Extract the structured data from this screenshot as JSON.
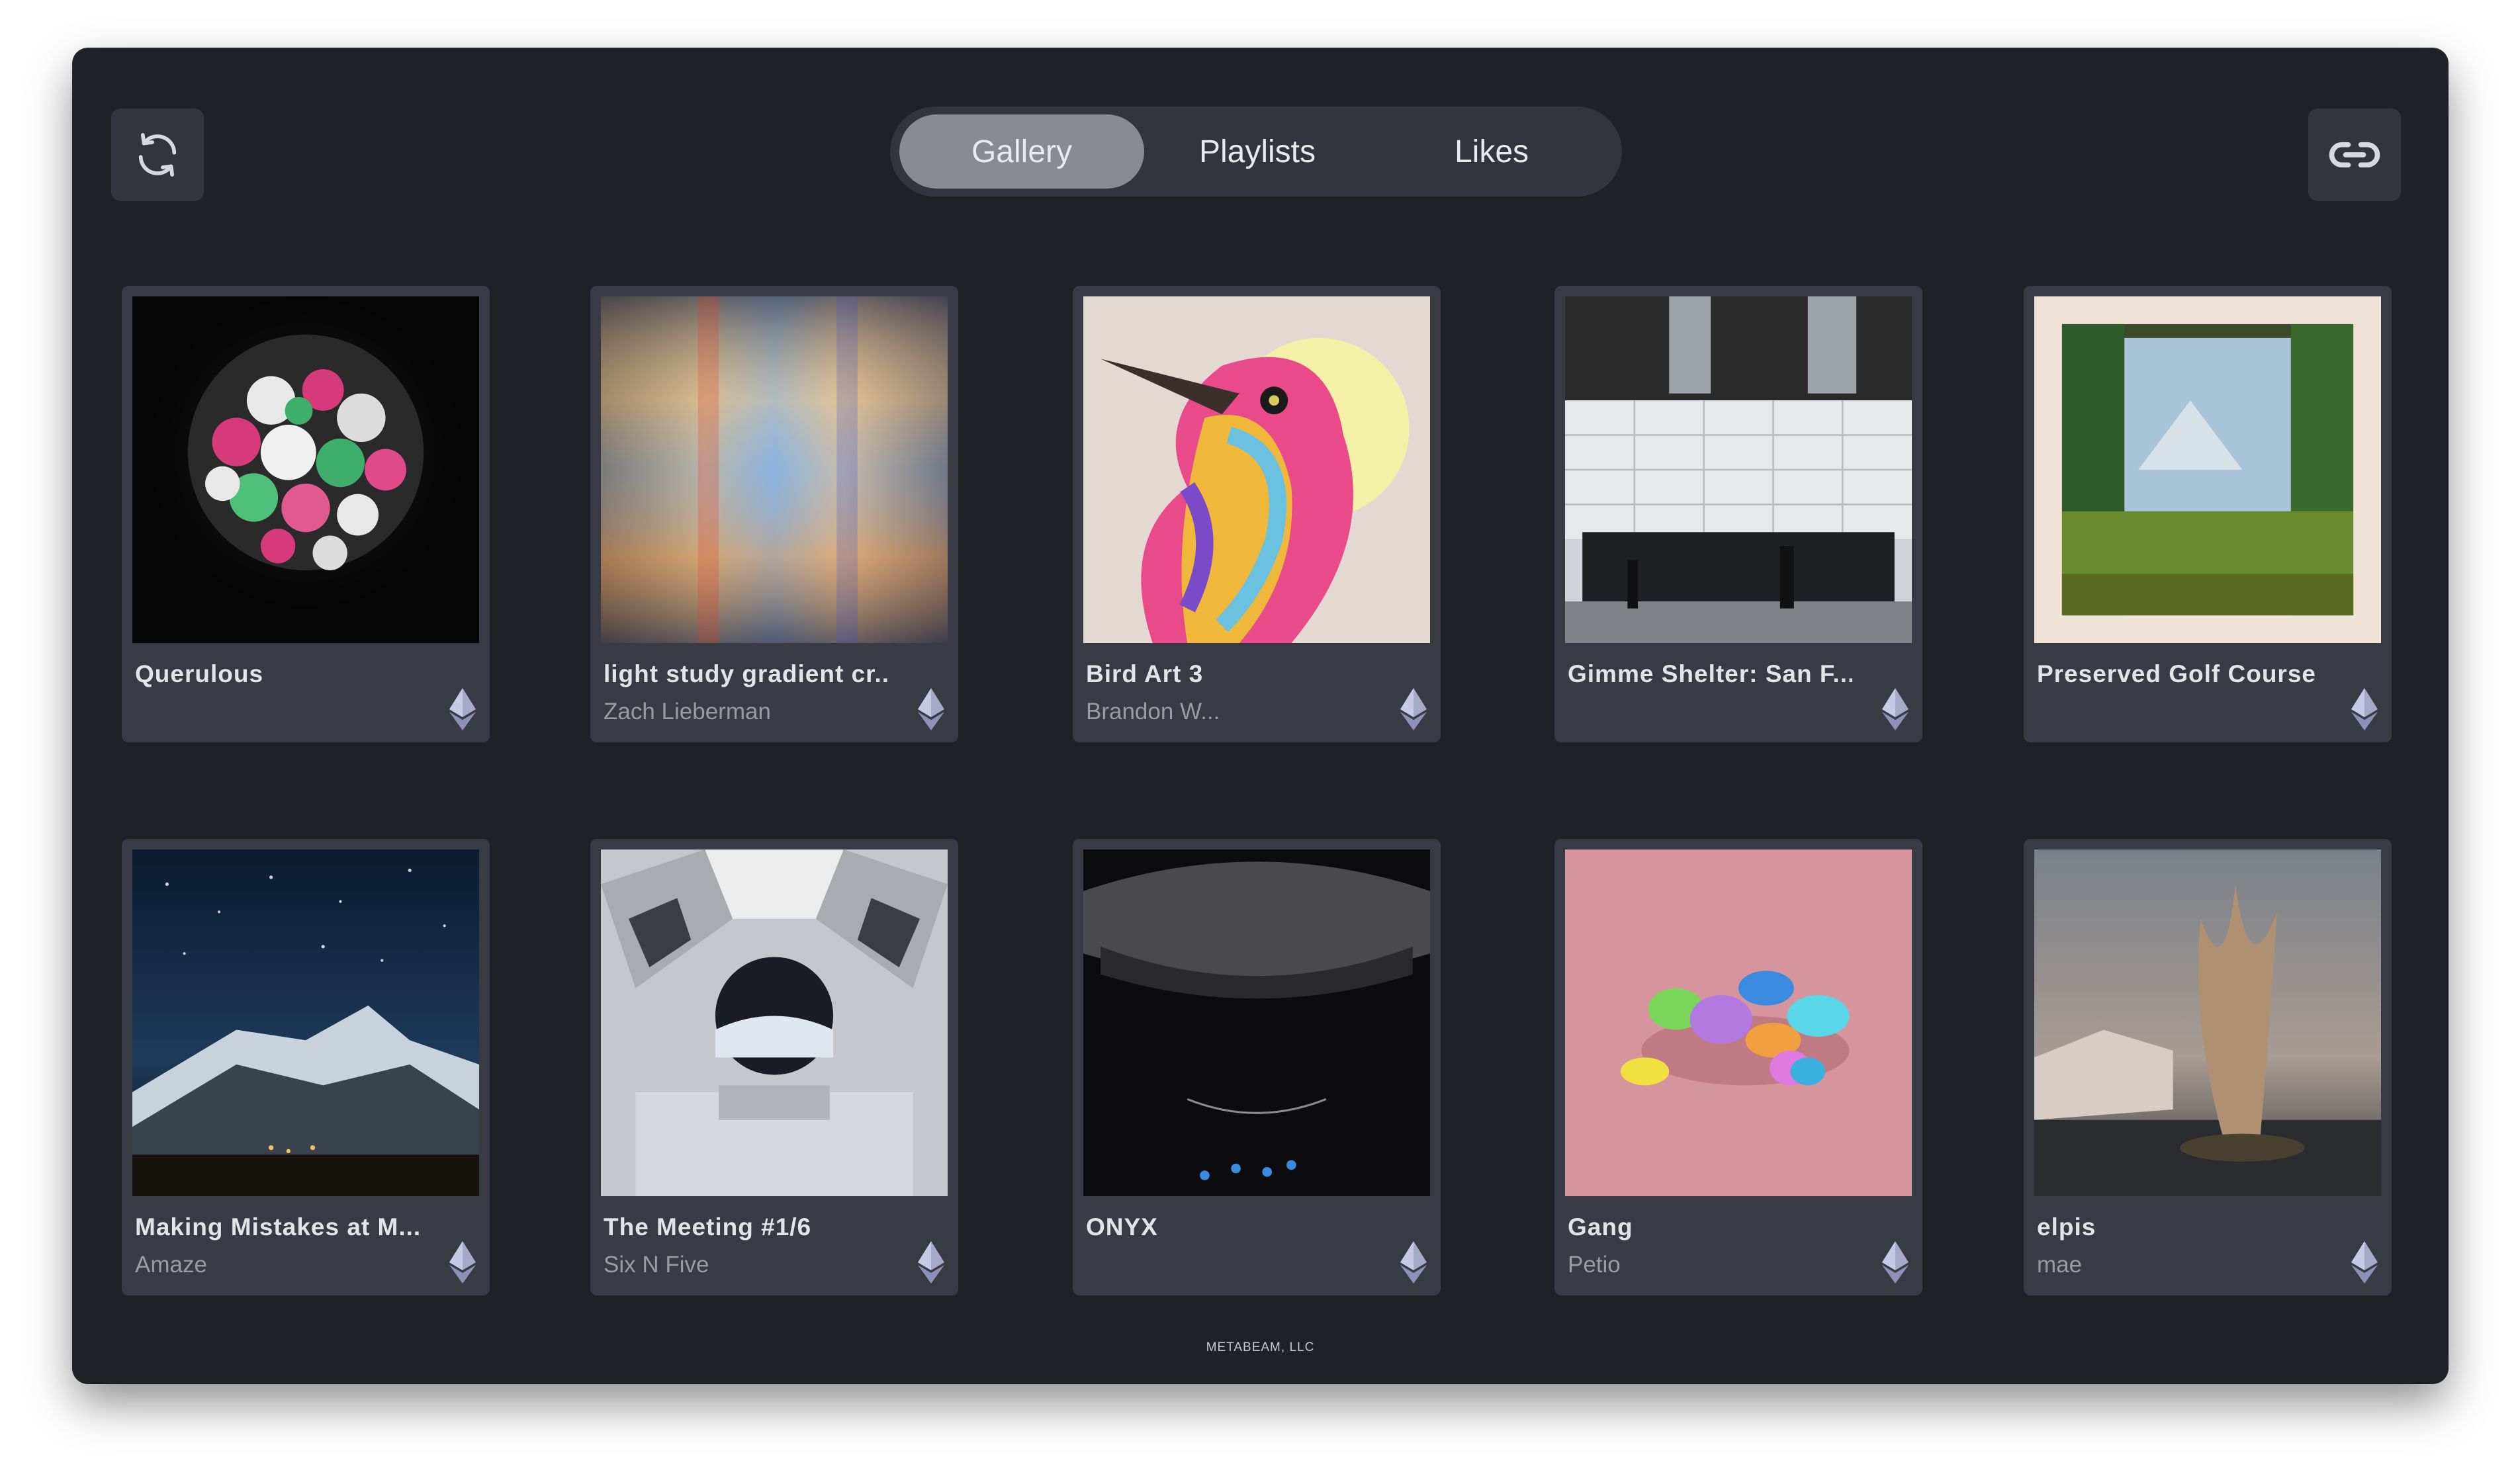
{
  "toolbar": {
    "refresh_icon": "refresh-icon",
    "link_icon": "link-icon"
  },
  "tabs": [
    {
      "label": "Gallery",
      "active": true
    },
    {
      "label": "Playlists",
      "active": false
    },
    {
      "label": "Likes",
      "active": false
    }
  ],
  "cards": [
    {
      "title": "Querulous",
      "artist": "",
      "chain_icon": "ethereum-icon"
    },
    {
      "title": "light study gradient cr...",
      "artist": "Zach Lieberman",
      "chain_icon": "ethereum-icon"
    },
    {
      "title": "Bird Art 3",
      "artist": "Brandon W...",
      "chain_icon": "ethereum-icon"
    },
    {
      "title": "Gimme Shelter: San F...",
      "artist": "",
      "chain_icon": "ethereum-icon"
    },
    {
      "title": "Preserved Golf Course",
      "artist": "",
      "chain_icon": "ethereum-icon"
    },
    {
      "title": "Making Mistakes at M...",
      "artist": "Amaze",
      "chain_icon": "ethereum-icon"
    },
    {
      "title": "The Meeting #1/6",
      "artist": "Six N Five",
      "chain_icon": "ethereum-icon"
    },
    {
      "title": "ONYX",
      "artist": "",
      "chain_icon": "ethereum-icon"
    },
    {
      "title": "Gang",
      "artist": "Petio",
      "chain_icon": "ethereum-icon"
    },
    {
      "title": "elpis",
      "artist": "mae",
      "chain_icon": "ethereum-icon"
    }
  ],
  "footer": {
    "text": "METABEAM, LLC"
  },
  "colors": {
    "background": "#202126",
    "card": "#393b44",
    "tab_active": "#8a8b90"
  }
}
